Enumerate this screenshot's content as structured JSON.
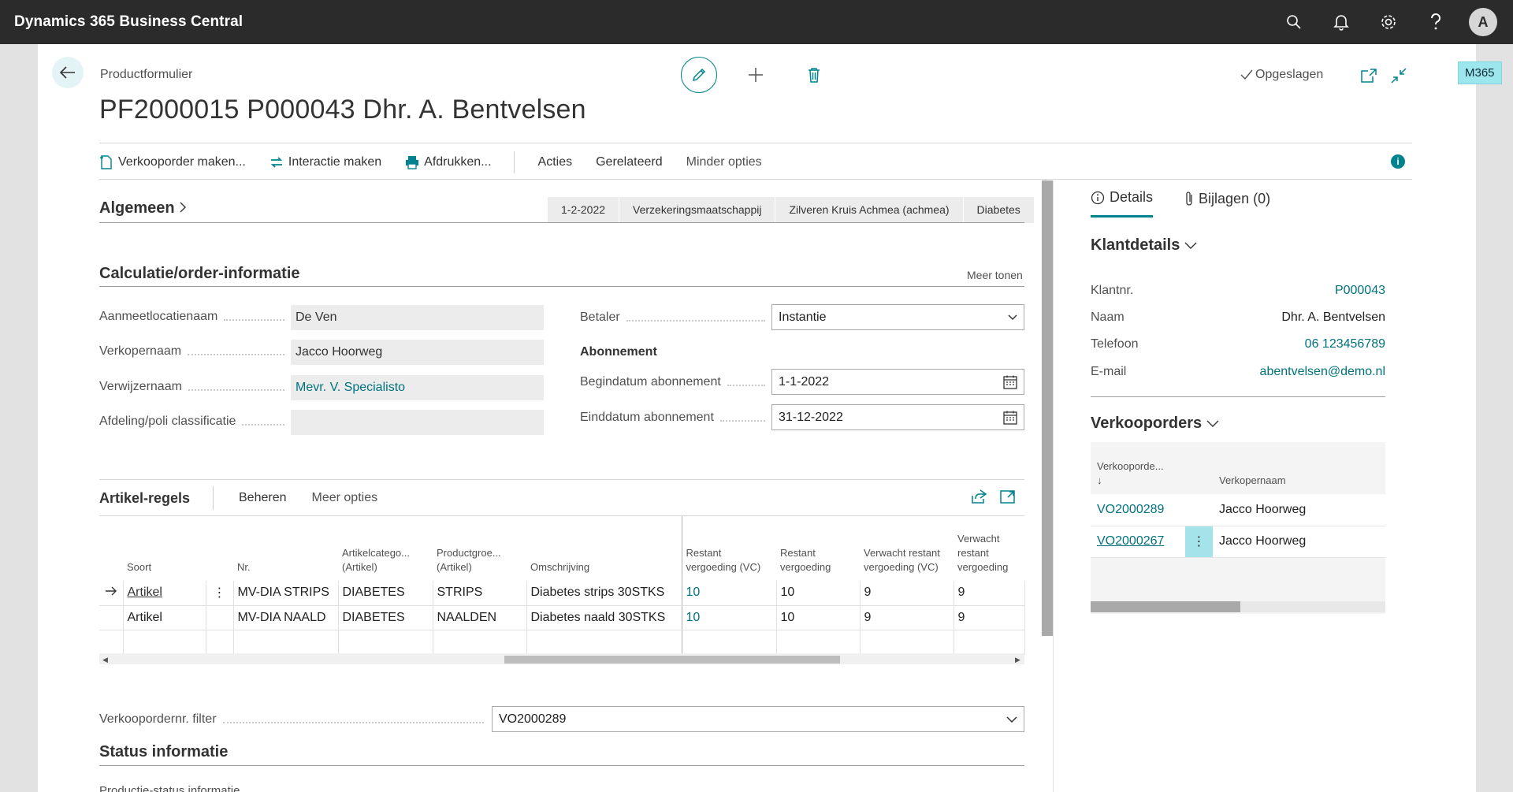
{
  "app": {
    "title": "Dynamics 365 Business Central",
    "avatar": "A"
  },
  "badge": "M365",
  "page": {
    "caption": "Productformulier",
    "title": "PF2000015 P000043 Dhr. A. Bentvelsen",
    "saved": "Opgeslagen"
  },
  "actions": {
    "create_order": "Verkooporder maken...",
    "create_interaction": "Interactie maken",
    "print": "Afdrukken...",
    "actions": "Acties",
    "related": "Gerelateerd",
    "fewer": "Minder opties"
  },
  "general": {
    "title": "Algemeen",
    "chips": [
      "1-2-2022",
      "Verzekeringsmaatschappij",
      "Zilveren Kruis Achmea (achmea)",
      "Diabetes"
    ]
  },
  "calc": {
    "title": "Calculatie/order-informatie",
    "show_more": "Meer tonen",
    "fields": {
      "location": {
        "label": "Aanmeetlocatienaam",
        "value": "De Ven"
      },
      "salesperson": {
        "label": "Verkopernaam",
        "value": "Jacco Hoorweg"
      },
      "referrer": {
        "label": "Verwijzernaam",
        "value": "Mevr. V. Specialisto"
      },
      "department": {
        "label": "Afdeling/poli classificatie",
        "value": ""
      },
      "payer": {
        "label": "Betaler",
        "value": "Instantie"
      },
      "subscription_heading": "Abonnement",
      "start": {
        "label": "Begindatum abonnement",
        "value": "1-1-2022"
      },
      "end": {
        "label": "Einddatum abonnement",
        "value": "31-12-2022"
      }
    }
  },
  "lines": {
    "title": "Artikel-regels",
    "manage": "Beheren",
    "more": "Meer opties",
    "columns": {
      "type": "Soort",
      "no": "Nr.",
      "category": "Artikelcatego... (Artikel)",
      "group": "Productgroe... (Artikel)",
      "description": "Omschrijving",
      "rest_vc": "Restant vergoeding (VC)",
      "rest": "Restant vergoeding",
      "exp_rest_vc": "Verwacht restant vergoeding (VC)",
      "exp_rest": "Verwacht restant vergoeding"
    },
    "rows": [
      {
        "type": "Artikel",
        "no": "MV-DIA STRIPS",
        "category": "DIABETES",
        "group": "STRIPS",
        "description": "Diabetes strips  30STKS",
        "rest_vc": "10",
        "rest": "10",
        "exp_rest_vc": "9",
        "exp_rest": "9"
      },
      {
        "type": "Artikel",
        "no": "MV-DIA NAALD",
        "category": "DIABETES",
        "group": "NAALDEN",
        "description": "Diabetes naald  30STKS",
        "rest_vc": "10",
        "rest": "10",
        "exp_rest_vc": "9",
        "exp_rest": "9"
      }
    ]
  },
  "filter": {
    "label": "Verkoopordernr. filter",
    "value": "VO2000289"
  },
  "status": {
    "title": "Status informatie",
    "sub": "Productie-status informatie"
  },
  "factbox": {
    "tab_details": "Details",
    "tab_attachments": "Bijlagen (0)",
    "customer": {
      "title": "Klantdetails",
      "rows": [
        {
          "k": "Klantnr.",
          "v": "P000043"
        },
        {
          "k": "Naam",
          "v": "Dhr. A. Bentvelsen"
        },
        {
          "k": "Telefoon",
          "v": "06 123456789"
        },
        {
          "k": "E-mail",
          "v": "abentvelsen@demo.nl"
        }
      ]
    },
    "orders": {
      "title": "Verkooporders",
      "col_no": "Verkooporde...",
      "col_sort": "↓",
      "col_sp": "Verkopernaam",
      "rows": [
        {
          "no": "VO2000289",
          "sp": "Jacco Hoorweg"
        },
        {
          "no": "VO2000267",
          "sp": "Jacco Hoorweg"
        }
      ]
    }
  }
}
